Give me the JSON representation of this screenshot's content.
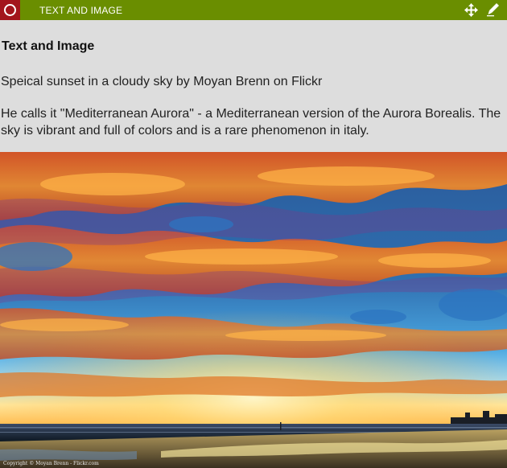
{
  "header": {
    "title": "TEXT AND IMAGE",
    "badge_icon": "ring-icon",
    "move_icon": "move-arrows-icon",
    "edit_icon": "pencil-icon",
    "colors": {
      "bar": "#6a8e00",
      "badge": "#a3151c",
      "text": "#ffffff"
    }
  },
  "content": {
    "heading": "Text and Image",
    "line1": "Speical sunset in a cloudy sky by Moyan Brenn on Flickr",
    "paragraph": "He calls it \"Mediterranean Aurora\" - a Mediterranean version of the Aurora Borealis. The sky is vibrant and full of colors and is a rare phenomenon in italy."
  },
  "image": {
    "copyright": "Copyright © Moyan Brenn - Flickr.com"
  },
  "colors": {
    "background": "#dddddd"
  }
}
